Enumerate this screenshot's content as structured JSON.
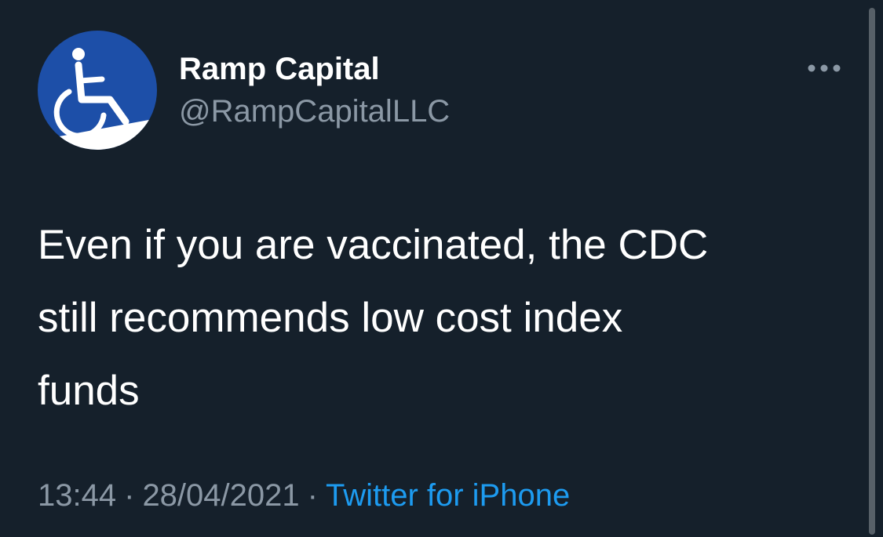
{
  "tweet": {
    "author": {
      "display_name": "Ramp Capital",
      "handle": "@RampCapitalLLC",
      "avatar_icon": "wheelchair-ramp-icon"
    },
    "text_lines": [
      "Even if you are vaccinated, the CDC",
      "still recommends low cost index",
      "funds"
    ],
    "meta": {
      "time": "13:44",
      "date": "28/04/2021",
      "separator": "·",
      "source": "Twitter for iPhone"
    },
    "more_icon": "more-dots-icon"
  },
  "colors": {
    "background": "#15202b",
    "text": "#ffffff",
    "secondary": "#8b98a5",
    "link": "#1d9bf0",
    "avatar": "#1d4fa8"
  }
}
